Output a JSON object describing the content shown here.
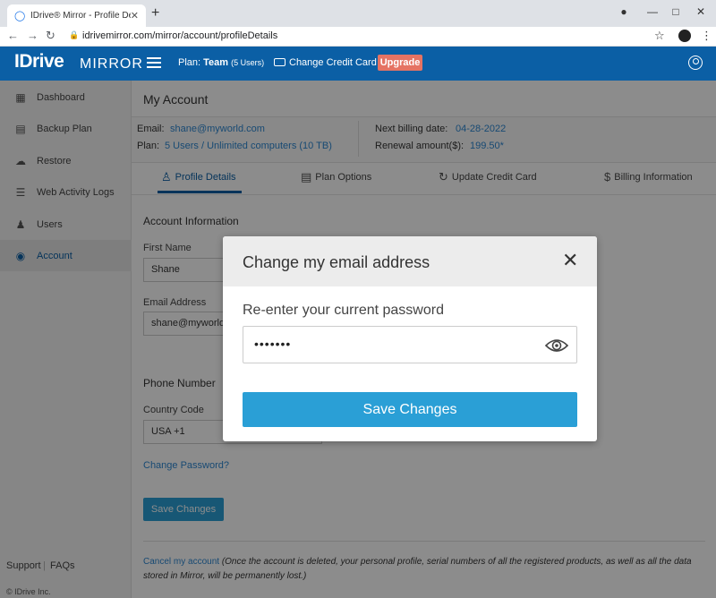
{
  "browser": {
    "tab_title": "IDrive® Mirror - Profile Details",
    "url": "idrivemirror.com/mirror/account/profileDetails"
  },
  "header": {
    "logo_main": "IDrive",
    "logo_sub": "MIRROR",
    "plan_prefix": "Plan:",
    "plan_name": "Team",
    "plan_users": "(5 Users)",
    "change_cc_label": "Change Credit Card",
    "upgrade_label": "Upgrade"
  },
  "sidebar": {
    "items": [
      {
        "label": "Dashboard",
        "icon": "dashboard-icon"
      },
      {
        "label": "Backup Plan",
        "icon": "backup-plan-icon"
      },
      {
        "label": "Restore",
        "icon": "restore-icon"
      },
      {
        "label": "Web Activity Logs",
        "icon": "logs-icon"
      },
      {
        "label": "Users",
        "icon": "users-icon"
      },
      {
        "label": "Account",
        "icon": "account-icon"
      }
    ],
    "support_label": "Support",
    "faqs_label": "FAQs",
    "copyright": "© IDrive Inc."
  },
  "main": {
    "title": "My Account",
    "summary": {
      "email_key": "Email:",
      "email_value": "shane@myworld.com",
      "plan_key": "Plan:",
      "plan_value": "5 Users / Unlimited computers (10 TB)",
      "billing_key": "Next billing date:",
      "billing_value": "04-28-2022",
      "renewal_key": "Renewal amount($):",
      "renewal_value": "199.50*"
    },
    "tabs": [
      {
        "label": "Profile Details"
      },
      {
        "label": "Plan Options"
      },
      {
        "label": "Update Credit Card"
      },
      {
        "label": "Billing Information"
      }
    ],
    "account_info_title": "Account Information",
    "first_name_label": "First Name",
    "first_name_value": "Shane",
    "email_label": "Email Address",
    "email_value": "shane@myworld.",
    "phone_title": "Phone Number",
    "country_code_label": "Country Code",
    "country_code_value": "USA +1",
    "change_password_link": "Change Password?",
    "save_changes_label": "Save Changes",
    "cancel_link": "Cancel my account",
    "cancel_note_1": "(Once the account is deleted, your personal profile, serial numbers of all the registered products, as well as all the data",
    "cancel_note_2": "stored in Mirror, will be permanently lost.)"
  },
  "modal": {
    "title": "Change my email address",
    "label": "Re-enter your current password",
    "password_mask": "•••••••",
    "save_label": "Save Changes"
  }
}
